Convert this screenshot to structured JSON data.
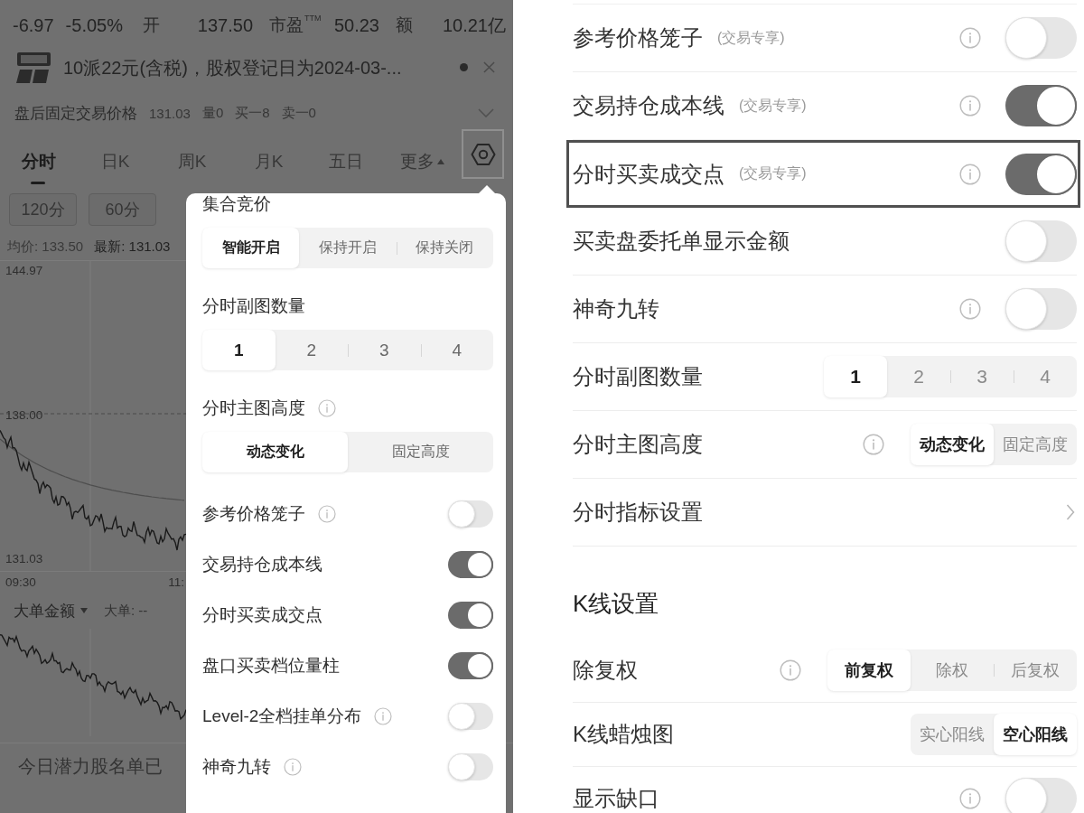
{
  "stock_screen": {
    "quote": {
      "change": "-6.97",
      "change_percent": "-5.05%",
      "stats": [
        {
          "label": "开",
          "value": "137.50"
        },
        {
          "label": "市盈$^{TTM}$",
          "value": "50.23"
        },
        {
          "label": "额",
          "value": "10.21亿"
        }
      ]
    },
    "notice": {
      "text": "10派22元(含税)，股权登记日为2024-03-...",
      "unread": true
    },
    "after_hours": {
      "label": "盘后固定交易价格",
      "values": [
        "131.03",
        "量0",
        "买一8",
        "卖一0"
      ]
    },
    "period_tabs": [
      {
        "label": "分时",
        "selected": true,
        "kind": "tab"
      },
      {
        "label": "日K",
        "selected": false,
        "kind": "tab"
      },
      {
        "label": "周K",
        "selected": false,
        "kind": "tab"
      },
      {
        "label": "月K",
        "selected": false,
        "kind": "tab"
      },
      {
        "label": "五日",
        "selected": false,
        "kind": "tab"
      },
      {
        "label": "更多",
        "selected": false,
        "kind": "menu"
      }
    ],
    "settings_button": {
      "highlighted": true
    },
    "interval_buttons": [
      "120分",
      "60分"
    ],
    "chart_info": {
      "average": "均价: 133.50",
      "latest": "最新: 131.03"
    },
    "price_chart": {
      "y_labels": [
        "144.97",
        "138.00",
        "131.03"
      ],
      "x_labels": [
        "09:30",
        "11:"
      ]
    },
    "flow_chart": {
      "metric": "大单金额",
      "reading": "大单: --"
    },
    "banner": "今日潜力股名单已"
  },
  "settings_popup": {
    "sections": [
      {
        "kind": "segmented",
        "title": "集合竞价",
        "info": false,
        "options": [
          {
            "label": "智能开启",
            "selected": true
          },
          {
            "label": "保持开启",
            "selected": false
          },
          {
            "label": "保持关闭",
            "selected": false
          }
        ]
      },
      {
        "kind": "segmented",
        "title": "分时副图数量",
        "info": false,
        "options": [
          {
            "label": "1",
            "selected": true
          },
          {
            "label": "2",
            "selected": false
          },
          {
            "label": "3",
            "selected": false
          },
          {
            "label": "4",
            "selected": false
          }
        ]
      },
      {
        "kind": "segmented",
        "title": "分时主图高度",
        "info": true,
        "options": [
          {
            "label": "动态变化",
            "selected": true
          },
          {
            "label": "固定高度",
            "selected": false
          }
        ]
      },
      {
        "kind": "toggle",
        "title": "参考价格笼子",
        "info": true,
        "on": false
      },
      {
        "kind": "toggle",
        "title": "交易持仓成本线",
        "info": false,
        "on": true
      },
      {
        "kind": "toggle",
        "title": "分时买卖成交点",
        "info": false,
        "on": true
      },
      {
        "kind": "toggle",
        "title": "盘口买卖档位量柱",
        "info": false,
        "on": true
      },
      {
        "kind": "toggle",
        "title": "Level-2全档挂单分布",
        "info": true,
        "on": false
      },
      {
        "kind": "toggle",
        "title": "神奇九转",
        "info": true,
        "on": false
      }
    ]
  },
  "settings_page": {
    "rows": [
      {
        "kind": "toggle",
        "label": "参考价格笼子",
        "tag": "(交易专享)",
        "info": true,
        "on": false,
        "highlighted": false
      },
      {
        "kind": "toggle",
        "label": "交易持仓成本线",
        "tag": "(交易专享)",
        "info": true,
        "on": true,
        "highlighted": false
      },
      {
        "kind": "toggle",
        "label": "分时买卖成交点",
        "tag": "(交易专享)",
        "info": true,
        "on": true,
        "highlighted": true
      },
      {
        "kind": "toggle",
        "label": "买卖盘委托单显示金额",
        "info": false,
        "on": false,
        "highlighted": false
      },
      {
        "kind": "toggle",
        "label": "神奇九转",
        "info": true,
        "on": false,
        "highlighted": false
      },
      {
        "kind": "segmented",
        "label": "分时副图数量",
        "info": false,
        "highlighted": false,
        "options": [
          {
            "label": "1",
            "selected": true
          },
          {
            "label": "2",
            "selected": false
          },
          {
            "label": "3",
            "selected": false
          },
          {
            "label": "4",
            "selected": false
          }
        ]
      },
      {
        "kind": "segmented",
        "label": "分时主图高度",
        "info": true,
        "highlighted": false,
        "options": [
          {
            "label": "动态变化",
            "selected": true
          },
          {
            "label": "固定高度",
            "selected": false
          }
        ]
      },
      {
        "kind": "link",
        "label": "分时指标设置",
        "info": false,
        "highlighted": false
      },
      {
        "kind": "heading",
        "label": "K线设置"
      },
      {
        "kind": "segmented",
        "label": "除复权",
        "info": true,
        "highlighted": false,
        "options": [
          {
            "label": "前复权",
            "selected": true
          },
          {
            "label": "除权",
            "selected": false
          },
          {
            "label": "后复权",
            "selected": false
          }
        ]
      },
      {
        "kind": "segmented",
        "label": "K线蜡烛图",
        "info": false,
        "highlighted": false,
        "options": [
          {
            "label": "实心阳线",
            "selected": false
          },
          {
            "label": "空心阳线",
            "selected": true
          }
        ]
      },
      {
        "kind": "toggle",
        "label": "显示缺口",
        "info": true,
        "on": false,
        "highlighted": false
      }
    ]
  }
}
